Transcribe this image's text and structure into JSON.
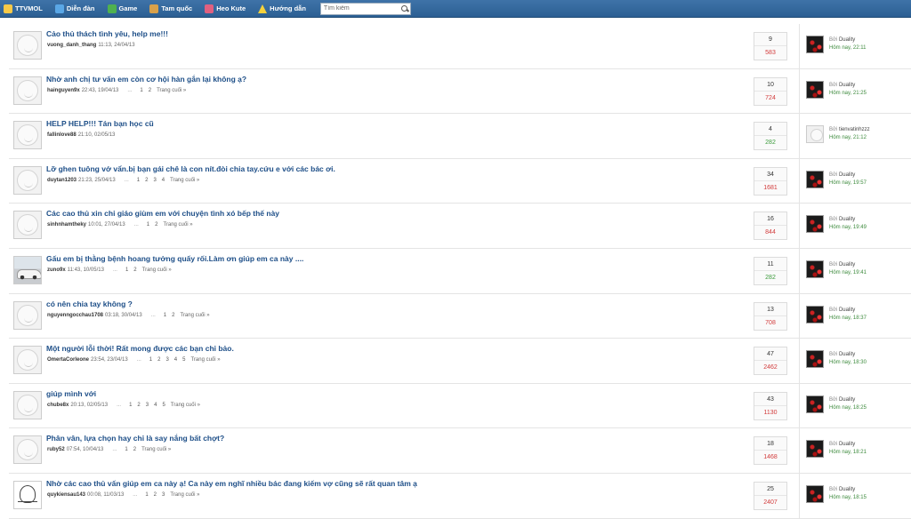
{
  "nav": {
    "items": [
      {
        "label": "TTVMOL",
        "icon": "home-icon",
        "cls": "ic-home"
      },
      {
        "label": "Diễn đàn",
        "icon": "forum-icon",
        "cls": "ic-forum"
      },
      {
        "label": "Game",
        "icon": "game-icon",
        "cls": "ic-game"
      },
      {
        "label": "Tam quốc",
        "icon": "tam-quoc-icon",
        "cls": "ic-tq"
      },
      {
        "label": "Heo Kute",
        "icon": "heo-kute-icon",
        "cls": "ic-heo"
      },
      {
        "label": "Hướng dẫn",
        "icon": "warning-icon",
        "cls": "ic-guide"
      }
    ],
    "search_placeholder": "Tìm kiếm"
  },
  "colors": {
    "nav_bg": "#2c5f93",
    "title": "#1e4f88",
    "views_hot": "#d23b3b",
    "views_normal": "#3c9b3c"
  },
  "threads": [
    {
      "title": "Cảo thủ thách tình yêu, help me!!!",
      "author": "vuong_danh_thang",
      "date": "11:13, 24/04/13",
      "pages": [],
      "replies": "9",
      "views": "583",
      "hot": true,
      "avatar": "smiley",
      "lp_by": "Bởi",
      "lp_user": "Duality",
      "lp_time": "Hôm nay, 22:11",
      "lp_avatar": "art"
    },
    {
      "title": "Nhờ anh chị tư vấn em còn cơ hội hàn gắn lại không ạ?",
      "author": "hainguyen9x",
      "date": "22:43, 19/04/13",
      "pages": [
        "1",
        "2"
      ],
      "replies": "10",
      "views": "724",
      "hot": true,
      "avatar": "smiley",
      "lp_by": "Bởi",
      "lp_user": "Duality",
      "lp_time": "Hôm nay, 21:25",
      "lp_avatar": "art"
    },
    {
      "title": "HELP HELP!!! Tán bạn học cũ",
      "author": "fallinlove88",
      "date": "21:10, 02/05/13",
      "pages": [],
      "replies": "4",
      "views": "282",
      "hot": false,
      "avatar": "smiley",
      "lp_by": "Bởi",
      "lp_user": "tienvatinhzzz",
      "lp_time": "Hôm nay, 21:12",
      "lp_avatar": "plain"
    },
    {
      "title": "Lỡ ghen tuông vớ vẩn.bị bạn gái chê là con nít.đòi chia tay.cứu e với các bác ơi.",
      "author": "duytan1203",
      "date": "21:23, 25/04/13",
      "pages": [
        "1",
        "2",
        "3",
        "4"
      ],
      "replies": "34",
      "views": "1681",
      "hot": true,
      "avatar": "smiley",
      "lp_by": "Bởi",
      "lp_user": "Duality",
      "lp_time": "Hôm nay, 19:57",
      "lp_avatar": "art"
    },
    {
      "title": "Các cao thủ xin chỉ giáo giùm em với chuyện tình xó bếp thế này",
      "author": "sinhnhamtheky",
      "date": "10:01, 27/04/13",
      "pages": [
        "1",
        "2"
      ],
      "replies": "16",
      "views": "844",
      "hot": true,
      "avatar": "smiley",
      "lp_by": "Bởi",
      "lp_user": "Duality",
      "lp_time": "Hôm nay, 19:49",
      "lp_avatar": "art"
    },
    {
      "title": "Gấu em bị thằng bệnh hoang tưởng quấy rối.Làm ơn giúp em ca này ....",
      "author": "zuno9x",
      "date": "11:43, 10/05/13",
      "pages": [
        "1",
        "2"
      ],
      "replies": "11",
      "views": "282",
      "hot": false,
      "avatar": "car",
      "lp_by": "Bởi",
      "lp_user": "Duality",
      "lp_time": "Hôm nay, 19:41",
      "lp_avatar": "art"
    },
    {
      "title": "có nên chia tay không ?",
      "author": "nguyenngocchau1708",
      "date": "03:18, 30/04/13",
      "pages": [
        "1",
        "2"
      ],
      "replies": "13",
      "views": "708",
      "hot": true,
      "avatar": "smiley",
      "lp_by": "Bởi",
      "lp_user": "Duality",
      "lp_time": "Hôm nay, 18:37",
      "lp_avatar": "art"
    },
    {
      "title": "Một người lỗi thời! Rất mong được các bạn chỉ bảo.",
      "author": "OmertaCorleone",
      "date": "23:54, 23/04/13",
      "pages": [
        "1",
        "2",
        "3",
        "4",
        "5"
      ],
      "replies": "47",
      "views": "2462",
      "hot": true,
      "avatar": "smiley",
      "lp_by": "Bởi",
      "lp_user": "Duality",
      "lp_time": "Hôm nay, 18:30",
      "lp_avatar": "art"
    },
    {
      "title": "giúp mình với",
      "author": "chube8x",
      "date": "20:13, 02/05/13",
      "pages": [
        "1",
        "2",
        "3",
        "4",
        "5"
      ],
      "replies": "43",
      "views": "1130",
      "hot": true,
      "avatar": "smiley",
      "lp_by": "Bởi",
      "lp_user": "Duality",
      "lp_time": "Hôm nay, 18:25",
      "lp_avatar": "art"
    },
    {
      "title": "Phân vân, lựa chọn hay chỉ là say nắng bất chợt?",
      "author": "ruby52",
      "date": "07:54, 10/04/13",
      "pages": [
        "1",
        "2"
      ],
      "replies": "18",
      "views": "1468",
      "hot": true,
      "avatar": "smiley",
      "lp_by": "Bởi",
      "lp_user": "Duality",
      "lp_time": "Hôm nay, 18:21",
      "lp_avatar": "art"
    },
    {
      "title": "Nhờ các cao thủ vấn giúp em ca này ạ! Ca này em nghĩ nhiều bác đang kiếm vợ cũng sẽ rất quan tâm ạ",
      "author": "quykiensau143",
      "date": "00:08, 11/03/13",
      "pages": [
        "1",
        "2",
        "3"
      ],
      "replies": "25",
      "views": "2407",
      "hot": true,
      "avatar": "sketch",
      "lp_by": "Bởi",
      "lp_user": "Duality",
      "lp_time": "Hôm nay, 18:15",
      "lp_avatar": "art"
    }
  ],
  "pager": {
    "dash": "...",
    "last_label": "Trang cuối »"
  }
}
